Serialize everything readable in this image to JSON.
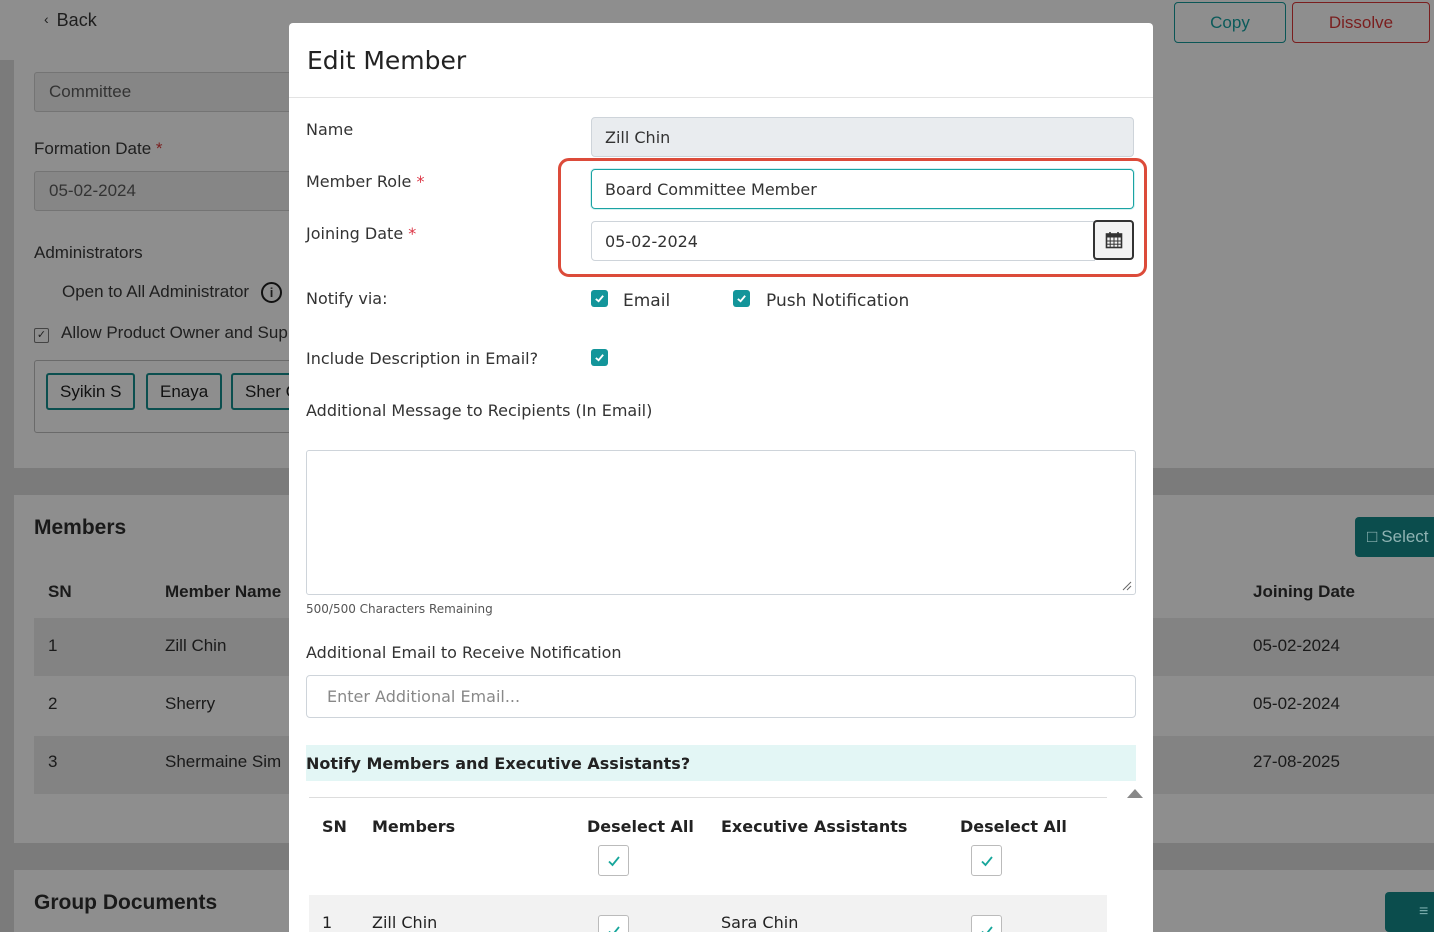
{
  "background": {
    "back_label": "Back",
    "copy_label": "Copy",
    "dissolve_label": "Dissolve",
    "committee_field": "Committee",
    "formation_date_label": "Formation Date",
    "formation_date_value": "05-02-2024",
    "administrators_label": "Administrators",
    "open_to_all_label": "Open to All Administrator",
    "allow_product_owner_label": "Allow Product Owner and Sup",
    "chips": [
      "Syikin S",
      "Enaya",
      "Sher C"
    ],
    "members_title": "Members",
    "select_button_label": "Select",
    "columns": {
      "sn": "SN",
      "member_name": "Member Name",
      "joining_date": "Joining Date"
    },
    "rows": [
      {
        "sn": "1",
        "name": "Zill Chin",
        "joining": "05-02-2024"
      },
      {
        "sn": "2",
        "name": "Sherry",
        "joining": "05-02-2024"
      },
      {
        "sn": "3",
        "name": "Shermaine Sim",
        "joining": "27-08-2025"
      }
    ],
    "group_documents_title": "Group Documents"
  },
  "modal": {
    "title": "Edit Member",
    "name_label": "Name",
    "name_value": "Zill Chin",
    "member_role_label": "Member Role",
    "member_role_value": "Board Committee Member",
    "joining_date_label": "Joining Date",
    "joining_date_value": "05-02-2024",
    "required_mark": "*",
    "notify_via_label": "Notify via:",
    "email_label": "Email",
    "push_label": "Push Notification",
    "include_desc_label": "Include Description in Email?",
    "additional_message_label": "Additional Message to Recipients (In Email)",
    "chars_remaining": "500/500 Characters Remaining",
    "additional_email_label": "Additional Email to Receive Notification",
    "additional_email_placeholder": "Enter Additional Email...",
    "notify_members_label": "Notify Members and Executive Assistants?",
    "table": {
      "sn": "SN",
      "members": "Members",
      "deselect_all_1": "Deselect All",
      "executive_assistants": "Executive Assistants",
      "deselect_all_2": "Deselect All",
      "rows": [
        {
          "sn": "1",
          "member": "Zill Chin",
          "assistant": "Sara Chin"
        }
      ]
    }
  },
  "colors": {
    "accent": "#13959a",
    "highlight": "#dc4b3a",
    "danger": "#7a1e1e"
  }
}
